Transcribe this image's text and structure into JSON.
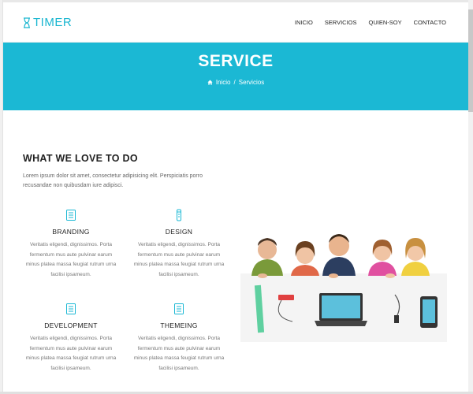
{
  "logo": {
    "text": "TIMER",
    "icon": "hourglass-icon"
  },
  "nav": {
    "items": [
      "INICIO",
      "SERVICIOS",
      "QUIEN-SOY",
      "CONTACTO"
    ]
  },
  "banner": {
    "title": "SERVICE",
    "breadcrumb": {
      "home": "Inicio",
      "separator": "/",
      "current": "Servicios"
    },
    "color": "#1bb8d4"
  },
  "intro": {
    "title": "WHAT WE LOVE TO DO",
    "description": "Lorem ipsum dolor sit amet, consectetur adipisicing elit. Perspiciatis porro recusandae non quibusdam iure adipisci."
  },
  "features": [
    {
      "icon": "document-icon",
      "title": "BRANDING",
      "text": "Veritatis eligendi, dignissimos. Porta fermentum mus aute pulvinar earum minus platea massa feugiat rutrum urna facilisi ipsameum."
    },
    {
      "icon": "tube-icon",
      "title": "DESIGN",
      "text": "Veritatis eligendi, dignissimos. Porta fermentum mus aute pulvinar earum minus platea massa feugiat rutrum urna facilisi ipsameum."
    },
    {
      "icon": "document-icon",
      "title": "DEVELOPMENT",
      "text": "Veritatis eligendi, dignissimos. Porta fermentum mus aute pulvinar earum minus platea massa feugiat rutrum urna facilisi ipsameum."
    },
    {
      "icon": "document-icon",
      "title": "THEMEING",
      "text": "Veritatis eligendi, dignissimos. Porta fermentum mus aute pulvinar earum minus platea massa feugiat rutrum urna facilisi ipsameum."
    }
  ],
  "colors": {
    "accent": "#1bb8d4",
    "logo": "#1ab6d0"
  }
}
